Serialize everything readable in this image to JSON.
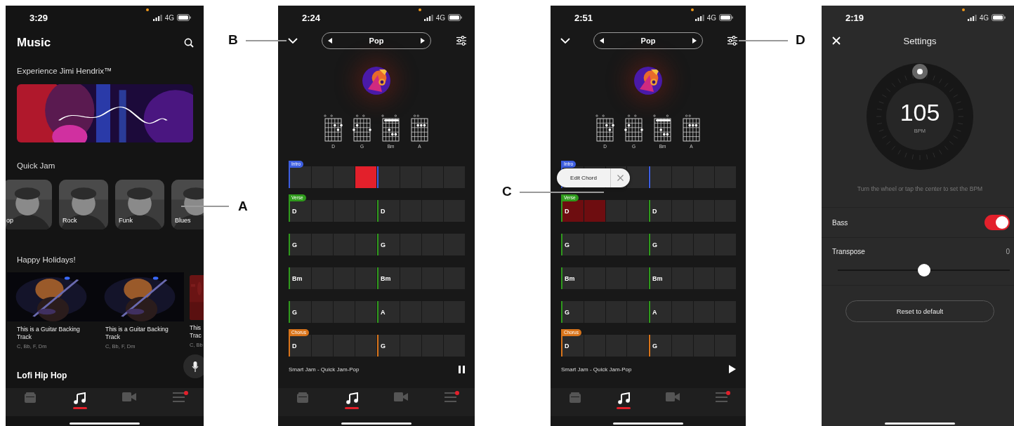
{
  "callouts": [
    {
      "label": "A"
    },
    {
      "label": "B"
    },
    {
      "label": "C"
    },
    {
      "label": "D"
    }
  ],
  "music_screen": {
    "status_time": "3:29",
    "network": "4G",
    "title": "Music",
    "featured": {
      "heading": "Experience Jimi Hendrix™"
    },
    "quick_jam": {
      "heading": "Quick Jam",
      "styles": [
        {
          "label": "op"
        },
        {
          "label": "Rock"
        },
        {
          "label": "Funk"
        },
        {
          "label": "Blues"
        }
      ]
    },
    "holidays": {
      "heading": "Happy Holidays!",
      "tracks": [
        {
          "kind": "concert",
          "title": "This is a Guitar Backing Track",
          "chords": "C, Bb, F, Dm"
        },
        {
          "kind": "concert",
          "title": "This is a Guitar Backing Track",
          "chords": "C, Bb, F, Dm"
        },
        {
          "kind": "plain",
          "title": "This Trac",
          "chords": "C, Bb"
        }
      ]
    },
    "next_heading": "Lofi Hip Hop",
    "nav": [
      {
        "kind": "amp",
        "selected": false,
        "badge": false
      },
      {
        "kind": "music",
        "selected": true,
        "badge": false
      },
      {
        "kind": "video",
        "selected": false,
        "badge": false
      },
      {
        "kind": "menu",
        "selected": false,
        "badge": true
      }
    ]
  },
  "jam_screens": [
    {
      "kind": "playing",
      "status_time": "2:24",
      "network": "4G",
      "style": "Pop",
      "chords": [
        {
          "name": "D"
        },
        {
          "name": "G"
        },
        {
          "name": "Bm"
        },
        {
          "name": "A"
        }
      ],
      "rows": [
        {
          "tag": "Intro",
          "color": "#3d5ee0",
          "cells": [
            {
              "selected": false
            },
            {
              "selected": false
            },
            {
              "selected": false
            },
            {
              "selected": true
            },
            {
              "selected": false
            },
            {
              "selected": false
            },
            {
              "selected": false
            },
            {
              "selected": false
            }
          ]
        },
        {
          "tag": "Verse",
          "color": "#2f9a1c",
          "cells": [
            {
              "chord": "D",
              "selected": false
            },
            {
              "selected": false
            },
            {
              "selected": false
            },
            {
              "selected": false
            },
            {
              "chord": "D",
              "selected": false
            },
            {
              "selected": false
            },
            {
              "selected": false
            },
            {
              "selected": false
            }
          ]
        },
        {
          "color": "#2f9a1c",
          "cells": [
            {
              "chord": "G",
              "selected": false
            },
            {
              "selected": false
            },
            {
              "selected": false
            },
            {
              "selected": false
            },
            {
              "chord": "G",
              "selected": false
            },
            {
              "selected": false
            },
            {
              "selected": false
            },
            {
              "selected": false
            }
          ]
        },
        {
          "color": "#2f9a1c",
          "cells": [
            {
              "chord": "Bm",
              "selected": false
            },
            {
              "selected": false
            },
            {
              "selected": false
            },
            {
              "selected": false
            },
            {
              "chord": "Bm",
              "selected": false
            },
            {
              "selected": false
            },
            {
              "selected": false
            },
            {
              "selected": false
            }
          ]
        },
        {
          "color": "#2f9a1c",
          "cells": [
            {
              "chord": "G",
              "selected": false
            },
            {
              "selected": false
            },
            {
              "selected": false
            },
            {
              "selected": false
            },
            {
              "chord": "A",
              "selected": false
            },
            {
              "selected": false
            },
            {
              "selected": false
            },
            {
              "selected": false
            }
          ]
        },
        {
          "tag": "Chorus",
          "color": "#d9741a",
          "cells": [
            {
              "chord": "D",
              "selected": false
            },
            {
              "selected": false
            },
            {
              "selected": false
            },
            {
              "selected": false
            },
            {
              "chord": "G",
              "selected": false
            },
            {
              "selected": false
            },
            {
              "selected": false
            },
            {
              "selected": false
            }
          ]
        }
      ],
      "track": "Smart Jam - Quick Jam-Pop",
      "playing": true,
      "nav": [
        {
          "kind": "amp",
          "selected": false,
          "badge": false
        },
        {
          "kind": "music",
          "selected": true,
          "badge": false
        },
        {
          "kind": "video",
          "selected": false,
          "badge": false
        },
        {
          "kind": "menu",
          "selected": false,
          "badge": true
        }
      ]
    },
    {
      "kind": "editing",
      "status_time": "2:51",
      "network": "4G",
      "style": "Pop",
      "chords": [
        {
          "name": "D"
        },
        {
          "name": "G"
        },
        {
          "name": "Bm"
        },
        {
          "name": "A"
        }
      ],
      "rows": [
        {
          "tag": "Intro",
          "color": "#3d5ee0",
          "cells": [
            {
              "selected": false
            },
            {
              "selected": false
            },
            {
              "selected": false
            },
            {
              "selected": false
            },
            {
              "selected": false
            },
            {
              "selected": false
            },
            {
              "selected": false
            },
            {
              "selected": false
            }
          ]
        },
        {
          "tag": "Verse",
          "color": "#2f9a1c",
          "cells": [
            {
              "chord": "D",
              "selected": true
            },
            {
              "selected": true
            },
            {
              "selected": false
            },
            {
              "selected": false
            },
            {
              "chord": "D",
              "selected": false
            },
            {
              "selected": false
            },
            {
              "selected": false
            },
            {
              "selected": false
            }
          ]
        },
        {
          "color": "#2f9a1c",
          "cells": [
            {
              "chord": "G",
              "selected": false
            },
            {
              "selected": false
            },
            {
              "selected": false
            },
            {
              "selected": false
            },
            {
              "chord": "G",
              "selected": false
            },
            {
              "selected": false
            },
            {
              "selected": false
            },
            {
              "selected": false
            }
          ]
        },
        {
          "color": "#2f9a1c",
          "cells": [
            {
              "chord": "Bm",
              "selected": false
            },
            {
              "selected": false
            },
            {
              "selected": false
            },
            {
              "selected": false
            },
            {
              "chord": "Bm",
              "selected": false
            },
            {
              "selected": false
            },
            {
              "selected": false
            },
            {
              "selected": false
            }
          ]
        },
        {
          "color": "#2f9a1c",
          "cells": [
            {
              "chord": "G",
              "selected": false
            },
            {
              "selected": false
            },
            {
              "selected": false
            },
            {
              "selected": false
            },
            {
              "chord": "A",
              "selected": false
            },
            {
              "selected": false
            },
            {
              "selected": false
            },
            {
              "selected": false
            }
          ]
        },
        {
          "tag": "Chorus",
          "color": "#d9741a",
          "cells": [
            {
              "chord": "D",
              "selected": false
            },
            {
              "selected": false
            },
            {
              "selected": false
            },
            {
              "selected": false
            },
            {
              "chord": "G",
              "selected": false
            },
            {
              "selected": false
            },
            {
              "selected": false
            },
            {
              "selected": false
            }
          ]
        }
      ],
      "popup": {
        "label": "Edit Chord"
      },
      "track": "Smart Jam - Quick Jam-Pop",
      "playing": false,
      "nav": [
        {
          "kind": "amp",
          "selected": false,
          "badge": false
        },
        {
          "kind": "music",
          "selected": true,
          "badge": false
        },
        {
          "kind": "video",
          "selected": false,
          "badge": false
        },
        {
          "kind": "menu",
          "selected": false,
          "badge": true
        }
      ]
    }
  ],
  "settings_screen": {
    "status_time": "2:19",
    "network": "4G",
    "title": "Settings",
    "bpm": "105",
    "bpm_unit": "BPM",
    "hint": "Turn the wheel or tap the center to set the BPM",
    "bass": {
      "label": "Bass",
      "on": true
    },
    "transpose": {
      "label": "Transpose",
      "value": "0",
      "level": 0.5
    },
    "reset_button": "Reset to default"
  }
}
